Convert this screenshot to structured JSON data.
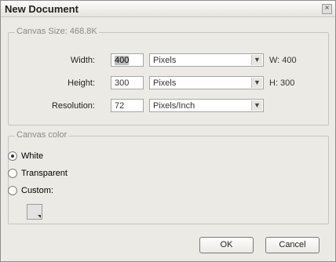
{
  "dialog": {
    "title": "New Document"
  },
  "canvas_size": {
    "legend": "Canvas Size: 468.8K",
    "width": {
      "label": "Width:",
      "value": "400",
      "unit": "Pixels",
      "readout": "W: 400"
    },
    "height": {
      "label": "Height:",
      "value": "300",
      "unit": "Pixels",
      "readout": "H: 300"
    },
    "resolution": {
      "label": "Resolution:",
      "value": "72",
      "unit": "Pixels/Inch"
    }
  },
  "canvas_color": {
    "legend": "Canvas color",
    "options": [
      "White",
      "Transparent",
      "Custom:"
    ],
    "selected": "White"
  },
  "buttons": {
    "ok": "OK",
    "cancel": "Cancel"
  }
}
